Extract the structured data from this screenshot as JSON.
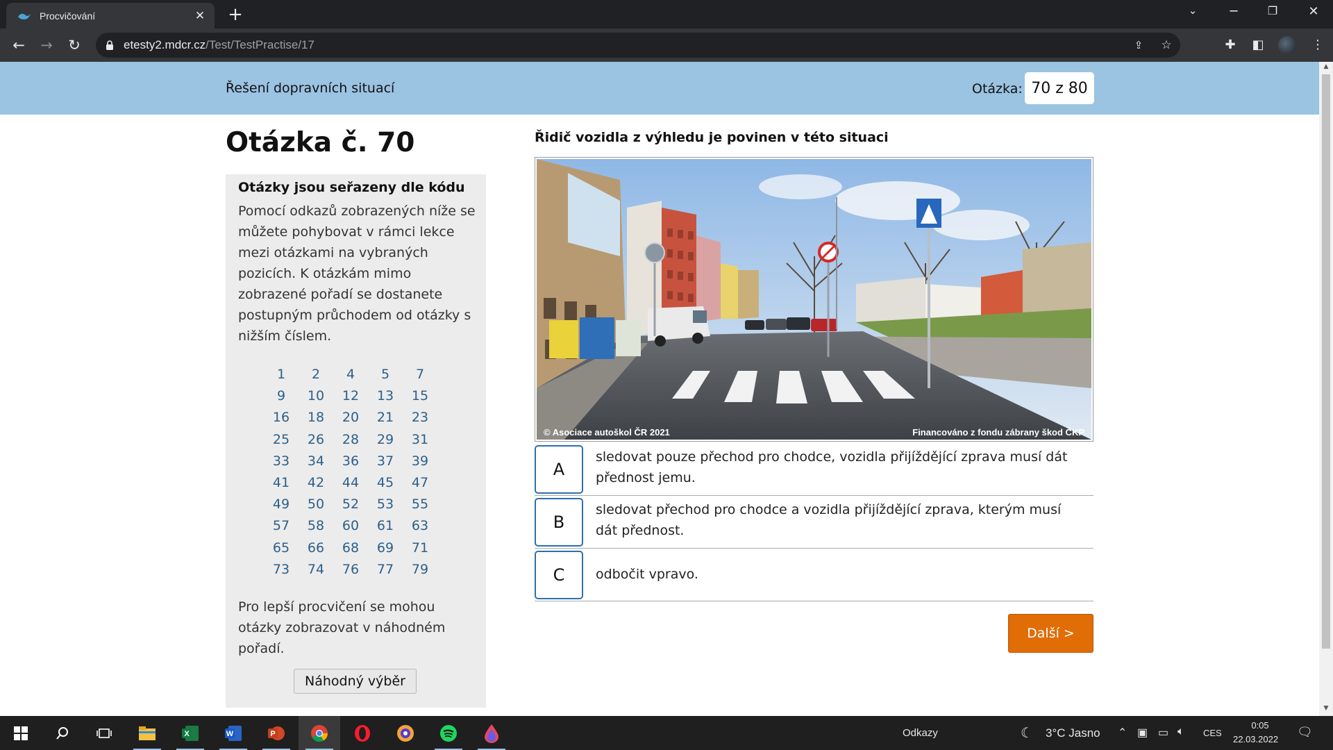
{
  "browser": {
    "tab_title": "Procvičování",
    "url_host": "etesty2.mdcr.cz",
    "url_path": "/Test/TestPractise/17"
  },
  "page": {
    "section_title": "Řešení dopravních situací",
    "counter_label": "Otázka:",
    "counter_value": "70 z 80",
    "question_heading": "Otázka č. 70",
    "question_text": "Řidič vozidla z výhledu je povinen v této situaci",
    "photo": {
      "copyright": "© Asociace autoškol ČR 2021",
      "funding": "Financováno z fondu zábrany škod ČKP"
    }
  },
  "sidebar": {
    "heading": "Otázky jsou seřazeny dle kódu",
    "text": "Pomocí odkazů zobrazených níže se můžete pohybovat v rámci lekce mezi otázkami na vybraných pozicích. K otázkám mimo zobrazené pořadí se dostanete postupným průchodem od otázky s nižším číslem.",
    "question_links": [
      "1",
      "2",
      "4",
      "5",
      "7",
      "9",
      "10",
      "12",
      "13",
      "15",
      "16",
      "18",
      "20",
      "21",
      "23",
      "25",
      "26",
      "28",
      "29",
      "31",
      "33",
      "34",
      "36",
      "37",
      "39",
      "41",
      "42",
      "44",
      "45",
      "47",
      "49",
      "50",
      "52",
      "53",
      "55",
      "57",
      "58",
      "60",
      "61",
      "63",
      "65",
      "66",
      "68",
      "69",
      "71",
      "73",
      "74",
      "76",
      "77",
      "79"
    ],
    "random_text": "Pro lepší procvičení se mohou otázky zobrazovat v náhodném pořadí.",
    "random_button": "Náhodný výběr"
  },
  "answers": [
    {
      "letter": "A",
      "text": "sledovat pouze přechod pro chodce, vozidla přijíždějící zprava musí dát přednost jemu."
    },
    {
      "letter": "B",
      "text": "sledovat přechod pro chodce a vozidla přijíždějící zprava, kterým musí dát přednost."
    },
    {
      "letter": "C",
      "text": "odbočit vpravo."
    }
  ],
  "next_button": "Další >",
  "taskbar": {
    "links_label": "Odkazy",
    "weather": "3°C  Jasno",
    "language": "CES",
    "time": "0:05",
    "date": "22.03.2022"
  },
  "colors": {
    "header_band": "#9bc3e2",
    "answer_border": "#2c6fae",
    "next_button": "#e06d06",
    "link": "#2c5f8a"
  }
}
